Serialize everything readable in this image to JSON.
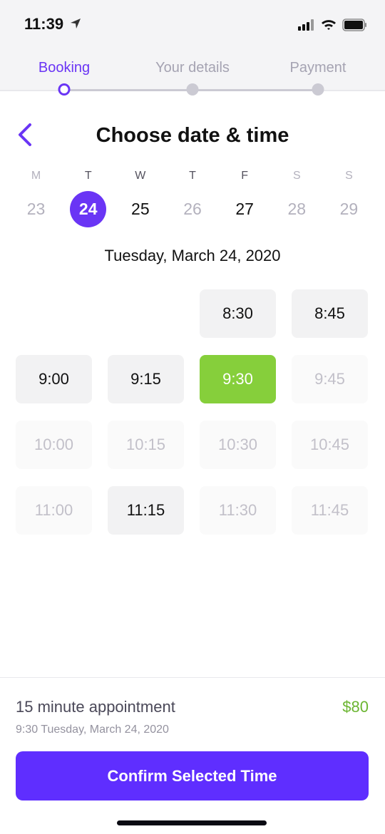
{
  "status_bar": {
    "time": "11:39"
  },
  "steps": [
    {
      "label": "Booking",
      "active": true
    },
    {
      "label": "Your details",
      "active": false
    },
    {
      "label": "Payment",
      "active": false
    }
  ],
  "header": {
    "title": "Choose date & time"
  },
  "week": [
    {
      "dow": "M",
      "day": "23",
      "state": "dim"
    },
    {
      "dow": "T",
      "day": "24",
      "state": "sel"
    },
    {
      "dow": "W",
      "day": "25",
      "state": ""
    },
    {
      "dow": "T",
      "day": "26",
      "state": "dimday"
    },
    {
      "dow": "F",
      "day": "27",
      "state": ""
    },
    {
      "dow": "S",
      "day": "28",
      "state": "dim"
    },
    {
      "dow": "S",
      "day": "29",
      "state": "dim"
    }
  ],
  "selected_date": "Tuesday, March 24, 2020",
  "slots": [
    {
      "time": "",
      "state": "empty"
    },
    {
      "time": "",
      "state": "empty"
    },
    {
      "time": "8:30",
      "state": "available"
    },
    {
      "time": "8:45",
      "state": "available"
    },
    {
      "time": "9:00",
      "state": "available"
    },
    {
      "time": "9:15",
      "state": "available"
    },
    {
      "time": "9:30",
      "state": "selected"
    },
    {
      "time": "9:45",
      "state": "disabled"
    },
    {
      "time": "10:00",
      "state": "disabled"
    },
    {
      "time": "10:15",
      "state": "disabled"
    },
    {
      "time": "10:30",
      "state": "disabled"
    },
    {
      "time": "10:45",
      "state": "disabled"
    },
    {
      "time": "11:00",
      "state": "disabled"
    },
    {
      "time": "11:15",
      "state": "available"
    },
    {
      "time": "11:30",
      "state": "disabled"
    },
    {
      "time": "11:45",
      "state": "disabled"
    }
  ],
  "summary": {
    "appointment": "15 minute appointment",
    "price": "$80",
    "detail": "9:30 Tuesday, March 24, 2020"
  },
  "confirm_label": "Confirm Selected Time",
  "colors": {
    "accent": "#5f2eff",
    "selected_slot": "#86cf3b",
    "price": "#6bb531"
  }
}
